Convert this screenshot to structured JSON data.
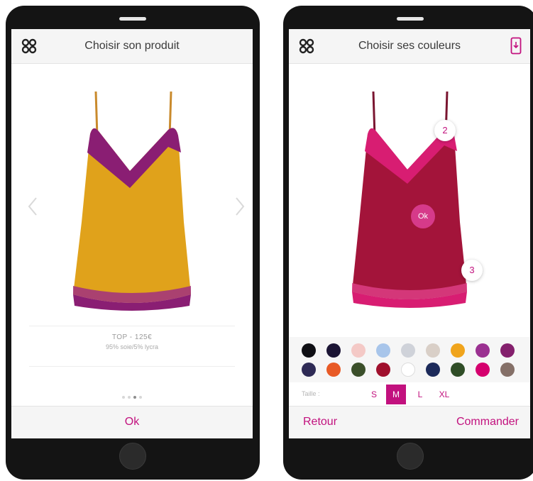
{
  "left_screen": {
    "header": {
      "logo_icon": "knot-logo-icon",
      "title": "Choisir son produit"
    },
    "garment_color": "#e0a21b",
    "trim_color": "#8a1e73",
    "strap_color": "#c98a2c",
    "prev_arrow_icon": "chevron-left-icon",
    "next_arrow_icon": "chevron-right-icon",
    "product": {
      "name": "TOP - 125€",
      "composition": "95% soie/5% lycra"
    },
    "pagination": {
      "count": 4,
      "active_index": 2
    },
    "footer": {
      "ok_label": "Ok"
    }
  },
  "right_screen": {
    "header": {
      "logo_icon": "knot-logo-icon",
      "title": "Choisir ses couleurs",
      "action_icon": "phone-download-icon"
    },
    "garment_color": "#a3143a",
    "trim_color": "#d81d72",
    "zone_badges": [
      "2",
      "3"
    ],
    "ok_badge": "Ok",
    "swatch_rows": [
      [
        "#0f0f14",
        "#1c1535",
        "#f4c9c6",
        "#a8c5ea",
        "#cfd2d9",
        "#d9cfc7",
        "#f0a41c",
        "#9b3191",
        "#84206d"
      ],
      [
        "#2e2a55",
        "#e85a26",
        "#3b4f2a",
        "#a0102d",
        "#ffffff",
        "#1c2a5a",
        "#2f4d26",
        "#d5006e",
        "#857068"
      ]
    ],
    "size_label": "Taille :",
    "sizes": [
      "S",
      "M",
      "L",
      "XL"
    ],
    "selected_size": "M",
    "footer": {
      "back_label": "Retour",
      "order_label": "Commander"
    }
  },
  "colors": {
    "accent": "#c2117e",
    "device": "#141414"
  }
}
